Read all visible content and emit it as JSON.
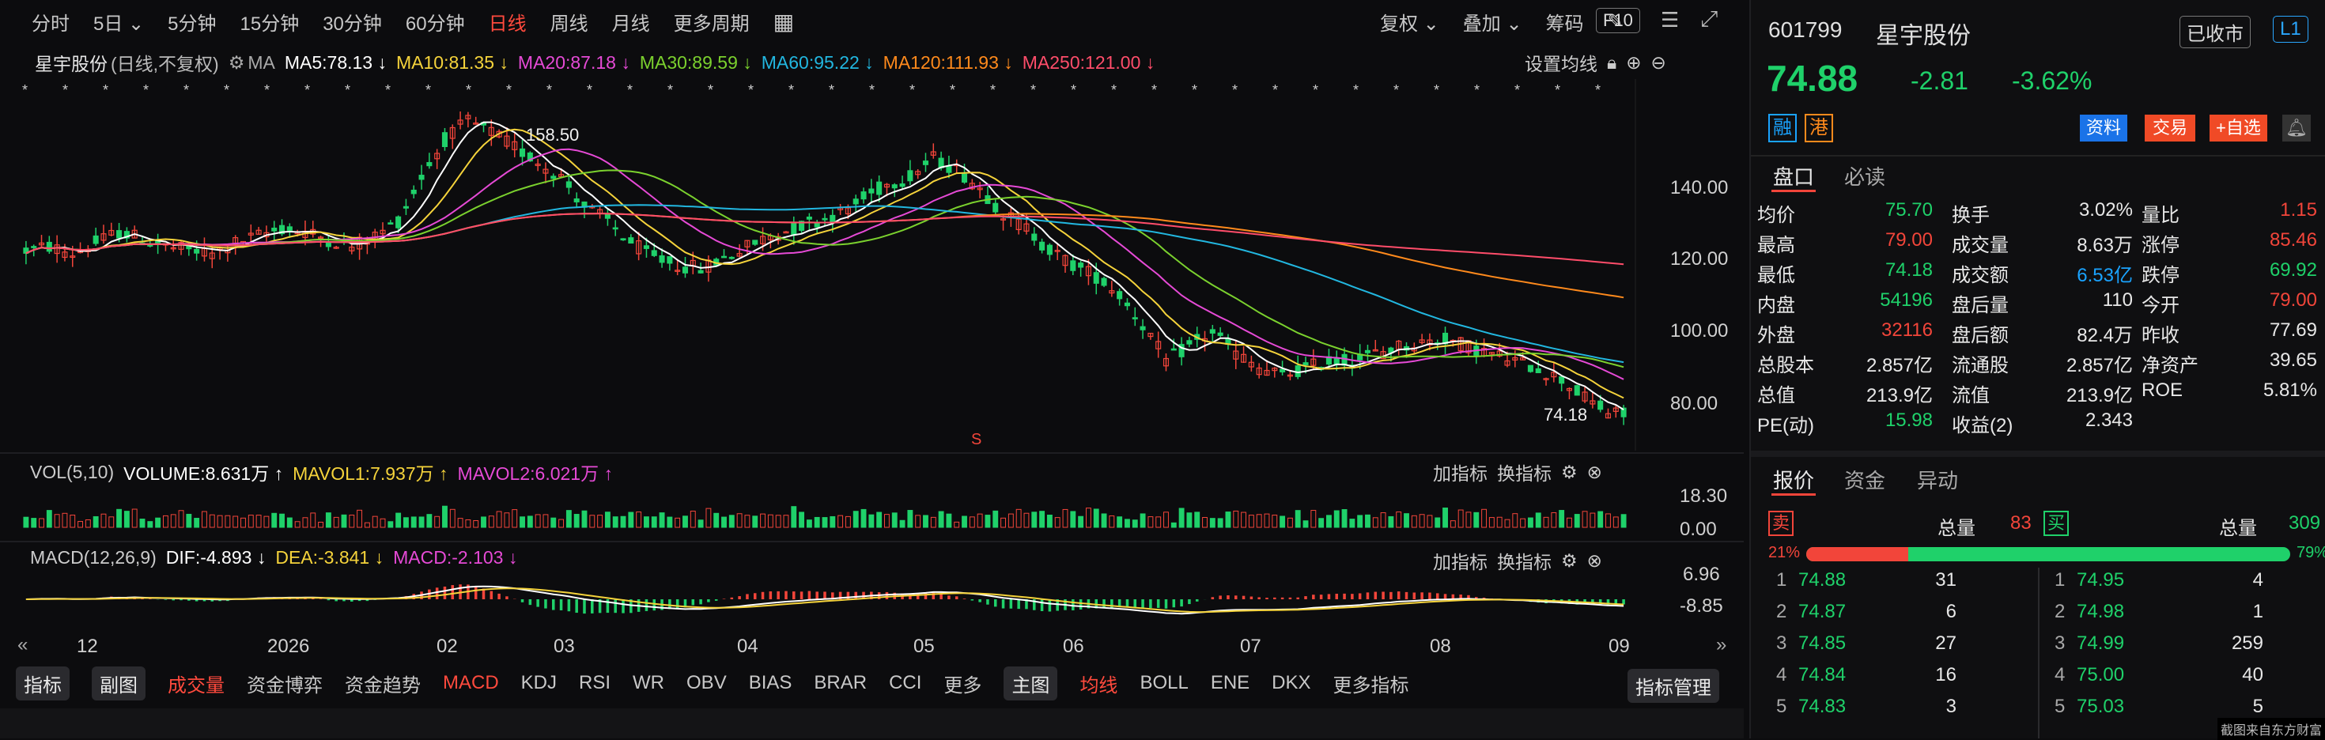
{
  "toolbar": {
    "periods": [
      "分时",
      "5日",
      "5分钟",
      "15分钟",
      "30分钟",
      "60分钟",
      "日线",
      "周线",
      "月线",
      "更多周期"
    ],
    "active_period": "日线",
    "right_items": [
      "复权",
      "叠加",
      "筹码"
    ],
    "f10": "F10"
  },
  "ma_legend": {
    "stock": "星宇股份",
    "mode": "(日线,不复权)",
    "ma_label": "MA",
    "items": [
      {
        "text": "MA5:78.13 ↓",
        "color": "#ffffff"
      },
      {
        "text": "MA10:81.35 ↓",
        "color": "#f5d33b"
      },
      {
        "text": "MA20:87.18 ↓",
        "color": "#e64ad6"
      },
      {
        "text": "MA30:89.59 ↓",
        "color": "#7bd12e"
      },
      {
        "text": "MA60:95.22 ↓",
        "color": "#22b7e0"
      },
      {
        "text": "MA120:111.93 ↓",
        "color": "#ff8a1c"
      },
      {
        "text": "MA250:121.00 ↓",
        "color": "#ff4d6a"
      }
    ],
    "setting": "设置均线"
  },
  "price_axis": [
    "140.00",
    "120.00",
    "100.00",
    "80.00"
  ],
  "annotations": {
    "high": "158.50",
    "low": "74.18",
    "marker": "S"
  },
  "vol_legend": {
    "name": "VOL(5,10)",
    "items": [
      {
        "text": "VOLUME:8.631万 ↑",
        "color": "#ffffff"
      },
      {
        "text": "MAVOL1:7.937万 ↑",
        "color": "#f5d33b"
      },
      {
        "text": "MAVOL2:6.021万 ↑",
        "color": "#e64ad6"
      }
    ],
    "axis": [
      "18.30",
      "0.00"
    ],
    "add": "加指标",
    "switch": "换指标"
  },
  "macd_legend": {
    "name": "MACD(12,26,9)",
    "items": [
      {
        "text": "DIF:-4.893 ↓",
        "color": "#ffffff"
      },
      {
        "text": "DEA:-3.841 ↓",
        "color": "#f5d33b"
      },
      {
        "text": "MACD:-2.103 ↓",
        "color": "#e64ad6"
      }
    ],
    "axis": [
      "6.96",
      "-8.85"
    ],
    "add": "加指标",
    "switch": "换指标"
  },
  "time_axis": [
    "12",
    "2026",
    "02",
    "03",
    "04",
    "05",
    "06",
    "07",
    "08",
    "09"
  ],
  "indicator_bar": {
    "left": [
      "指标",
      "副图",
      "成交量",
      "资金博弈",
      "资金趋势",
      "MACD",
      "KDJ",
      "RSI",
      "WR",
      "OBV",
      "BIAS",
      "BRAR",
      "CCI",
      "更多"
    ],
    "main": [
      "主图",
      "均线",
      "BOLL",
      "ENE",
      "DKX",
      "更多指标"
    ],
    "manage": "指标管理"
  },
  "quote": {
    "code": "601799",
    "name": "星宇股份",
    "status": "已收市",
    "level": "L1",
    "price": "74.88",
    "change": "-2.81",
    "pct": "-3.62%",
    "badges": [
      "融",
      "港"
    ],
    "actions": [
      "资料",
      "交易",
      "+自选"
    ]
  },
  "panel_tabs": [
    "盘口",
    "必读"
  ],
  "stats": [
    [
      "均价",
      "75.70",
      "换手",
      "3.02%",
      "量比",
      "1.15"
    ],
    [
      "最高",
      "79.00",
      "成交量",
      "8.63万",
      "涨停",
      "85.46"
    ],
    [
      "最低",
      "74.18",
      "成交额",
      "6.53亿",
      "跌停",
      "69.92"
    ],
    [
      "内盘",
      "54196",
      "盘后量",
      "110",
      "今开",
      "79.00"
    ],
    [
      "外盘",
      "32116",
      "盘后额",
      "82.4万",
      "昨收",
      "77.69"
    ],
    [
      "总股本",
      "2.857亿",
      "流通股",
      "2.857亿",
      "净资产",
      "39.65"
    ],
    [
      "总值",
      "213.9亿",
      "流值",
      "213.9亿",
      "ROE",
      "5.81%"
    ],
    [
      "PE(动)",
      "15.98",
      "收益(2)",
      "2.343",
      "",
      ""
    ]
  ],
  "order_tabs": [
    "报价",
    "资金",
    "异动"
  ],
  "order_book": {
    "sell_label": "卖",
    "buy_label": "买",
    "total_label": "总量",
    "sell_total": "83",
    "buy_total": "309",
    "sell_pct": "21%",
    "buy_pct": "79%",
    "sell_ratio": 0.21,
    "rows_left": [
      [
        "1",
        "74.88",
        "31"
      ],
      [
        "2",
        "74.87",
        "6"
      ],
      [
        "3",
        "74.85",
        "27"
      ],
      [
        "4",
        "74.84",
        "16"
      ],
      [
        "5",
        "74.83",
        "3"
      ]
    ],
    "rows_right": [
      [
        "1",
        "74.95",
        "4"
      ],
      [
        "2",
        "74.98",
        "1"
      ],
      [
        "3",
        "74.99",
        "259"
      ],
      [
        "4",
        "75.00",
        "40"
      ],
      [
        "5",
        "75.03",
        "5"
      ]
    ]
  },
  "watermark": "截图来自东方财富",
  "chart_data": {
    "type": "candlestick",
    "ylim": [
      70,
      160
    ],
    "x_ticks": [
      "12",
      "2026",
      "02",
      "03",
      "04",
      "05",
      "06",
      "07",
      "08",
      "09"
    ],
    "close_approx": [
      120,
      121,
      119,
      122,
      125,
      123,
      121,
      120,
      119,
      122,
      124,
      126,
      125,
      123,
      121,
      124,
      128,
      140,
      150,
      155,
      152,
      148,
      144,
      140,
      132,
      128,
      122,
      118,
      116,
      115,
      118,
      121,
      124,
      126,
      128,
      130,
      134,
      138,
      140,
      145,
      142,
      137,
      130,
      126,
      120,
      116,
      113,
      108,
      100,
      90,
      94,
      98,
      92,
      88,
      86,
      88,
      90,
      90,
      92,
      94,
      95,
      96,
      94,
      92,
      90,
      88,
      85,
      80,
      76,
      75
    ],
    "volume_max": 18.3,
    "macd_range": [
      -8.85,
      6.96
    ]
  }
}
